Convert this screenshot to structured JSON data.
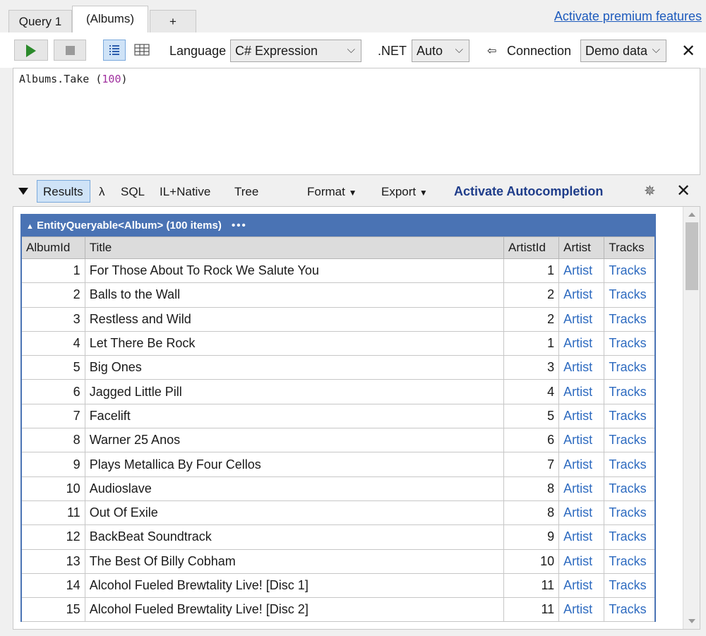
{
  "tabs": [
    {
      "label": "Query 1"
    },
    {
      "label": "(Albums)"
    },
    {
      "label": "+"
    }
  ],
  "premium_link": "Activate premium features",
  "toolbar": {
    "language_label": "Language",
    "language_value": "C# Expression",
    "net_label": ".NET",
    "net_value": "Auto",
    "connection_label": "Connection",
    "connection_value": "Demo data"
  },
  "editor": {
    "code_prefix": "Albums.Take (",
    "code_number": "100",
    "code_suffix": ")"
  },
  "results_bar": {
    "results": "Results",
    "lambda": "λ",
    "sql": "SQL",
    "il_native": "IL+Native",
    "tree": "Tree",
    "format": "Format",
    "export": "Export",
    "autocompletion": "Activate Autocompletion"
  },
  "grid": {
    "header": "EntityQueryable<Album> (100 items)",
    "header_dots": "•••",
    "columns": [
      "AlbumId",
      "Title",
      "ArtistId",
      "Artist",
      "Tracks"
    ],
    "rows": [
      {
        "id": "1",
        "title": "For Those About To Rock We Salute You",
        "artist_id": "1",
        "artist": "Artist",
        "tracks": "Tracks"
      },
      {
        "id": "2",
        "title": "Balls to the Wall",
        "artist_id": "2",
        "artist": "Artist",
        "tracks": "Tracks"
      },
      {
        "id": "3",
        "title": "Restless and Wild",
        "artist_id": "2",
        "artist": "Artist",
        "tracks": "Tracks"
      },
      {
        "id": "4",
        "title": "Let There Be Rock",
        "artist_id": "1",
        "artist": "Artist",
        "tracks": "Tracks"
      },
      {
        "id": "5",
        "title": "Big Ones",
        "artist_id": "3",
        "artist": "Artist",
        "tracks": "Tracks"
      },
      {
        "id": "6",
        "title": "Jagged Little Pill",
        "artist_id": "4",
        "artist": "Artist",
        "tracks": "Tracks"
      },
      {
        "id": "7",
        "title": "Facelift",
        "artist_id": "5",
        "artist": "Artist",
        "tracks": "Tracks"
      },
      {
        "id": "8",
        "title": "Warner 25 Anos",
        "artist_id": "6",
        "artist": "Artist",
        "tracks": "Tracks"
      },
      {
        "id": "9",
        "title": "Plays Metallica By Four Cellos",
        "artist_id": "7",
        "artist": "Artist",
        "tracks": "Tracks"
      },
      {
        "id": "10",
        "title": "Audioslave",
        "artist_id": "8",
        "artist": "Artist",
        "tracks": "Tracks"
      },
      {
        "id": "11",
        "title": "Out Of Exile",
        "artist_id": "8",
        "artist": "Artist",
        "tracks": "Tracks"
      },
      {
        "id": "12",
        "title": "BackBeat Soundtrack",
        "artist_id": "9",
        "artist": "Artist",
        "tracks": "Tracks"
      },
      {
        "id": "13",
        "title": "The Best Of Billy Cobham",
        "artist_id": "10",
        "artist": "Artist",
        "tracks": "Tracks"
      },
      {
        "id": "14",
        "title": "Alcohol Fueled Brewtality Live! [Disc 1]",
        "artist_id": "11",
        "artist": "Artist",
        "tracks": "Tracks"
      },
      {
        "id": "15",
        "title": "Alcohol Fueled Brewtality Live! [Disc 2]",
        "artist_id": "11",
        "artist": "Artist",
        "tracks": "Tracks"
      }
    ]
  }
}
